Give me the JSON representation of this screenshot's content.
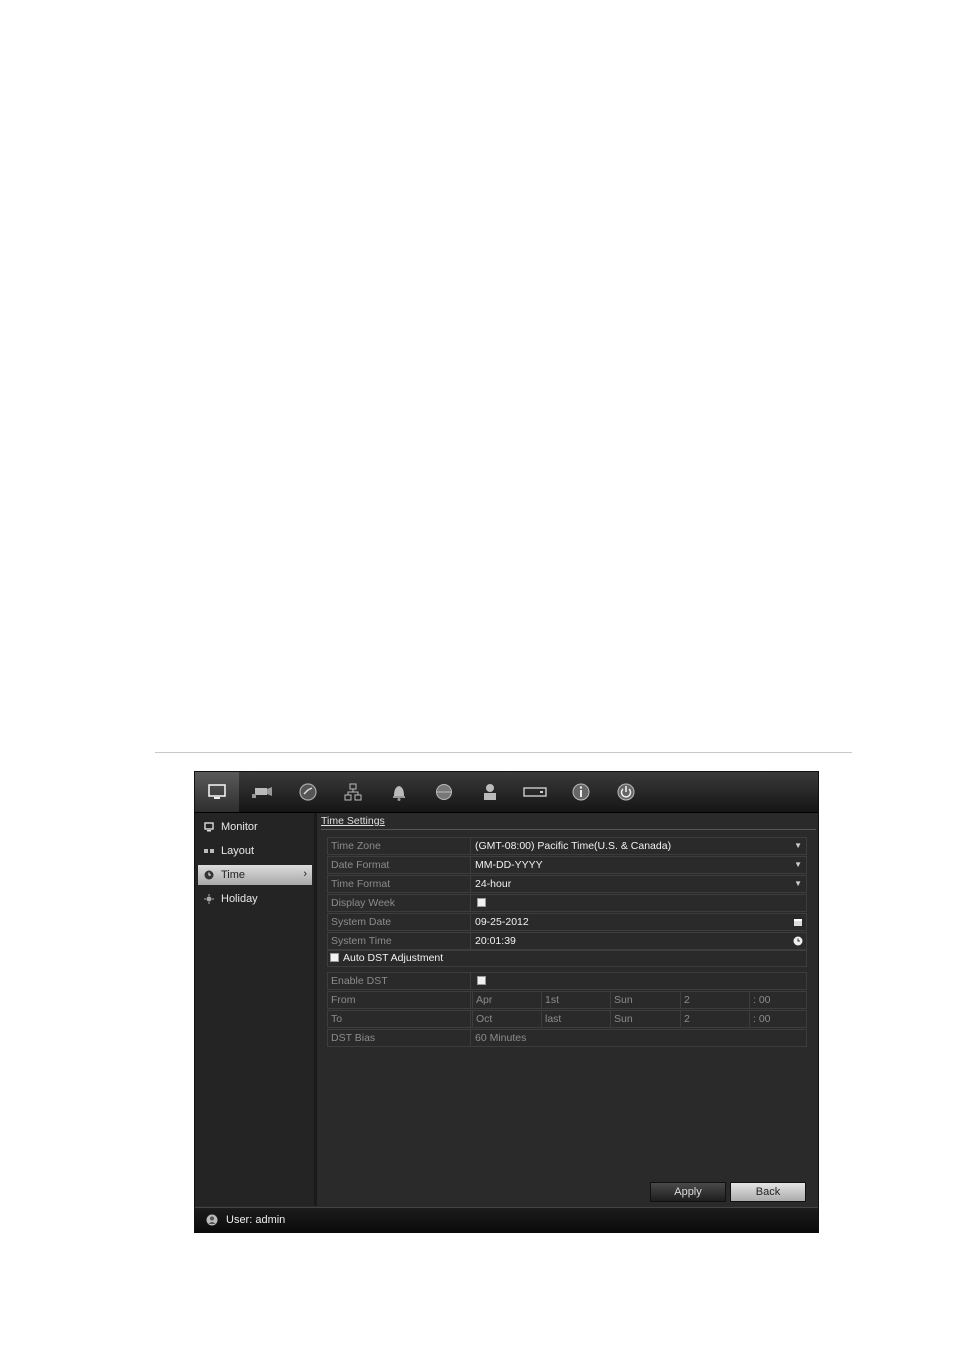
{
  "toolbar": {
    "tabs": [
      {
        "icon": "monitor-icon",
        "active": true
      },
      {
        "icon": "camera-icon"
      },
      {
        "icon": "record-icon"
      },
      {
        "icon": "network-icon"
      },
      {
        "icon": "alarm-bell-icon"
      },
      {
        "icon": "ptz-icon"
      },
      {
        "icon": "user-icon"
      },
      {
        "icon": "hdd-icon"
      },
      {
        "icon": "info-icon"
      },
      {
        "icon": "power-icon"
      }
    ]
  },
  "sidebar": {
    "items": [
      {
        "label": "Monitor",
        "icon": "monitor-icon"
      },
      {
        "label": "Layout",
        "icon": "layout-icon"
      },
      {
        "label": "Time",
        "icon": "clock-icon",
        "active": true
      },
      {
        "label": "Holiday",
        "icon": "holiday-icon"
      }
    ]
  },
  "main": {
    "section_title": "Time Settings",
    "time_zone": {
      "label": "Time Zone",
      "value": "(GMT-08:00) Pacific Time(U.S. & Canada)"
    },
    "date_format": {
      "label": "Date Format",
      "value": "MM-DD-YYYY"
    },
    "time_format": {
      "label": "Time Format",
      "value": "24-hour"
    },
    "display_week": {
      "label": "Display Week"
    },
    "system_date": {
      "label": "System Date",
      "value": "09-25-2012"
    },
    "system_time": {
      "label": "System Time",
      "value": "20:01:39"
    },
    "auto_dst": {
      "label": "Auto DST Adjustment"
    },
    "enable_dst": {
      "label": "Enable DST"
    },
    "from": {
      "label": "From",
      "month": "Apr",
      "week": "1st",
      "day": "Sun",
      "hour": "2",
      "minute": ": 00"
    },
    "to": {
      "label": "To",
      "month": "Oct",
      "week": "last",
      "day": "Sun",
      "hour": "2",
      "minute": ": 00"
    },
    "dst_bias": {
      "label": "DST Bias",
      "value": "60 Minutes"
    },
    "apply_label": "Apply",
    "back_label": "Back"
  },
  "status": {
    "user_text": "User: admin"
  }
}
